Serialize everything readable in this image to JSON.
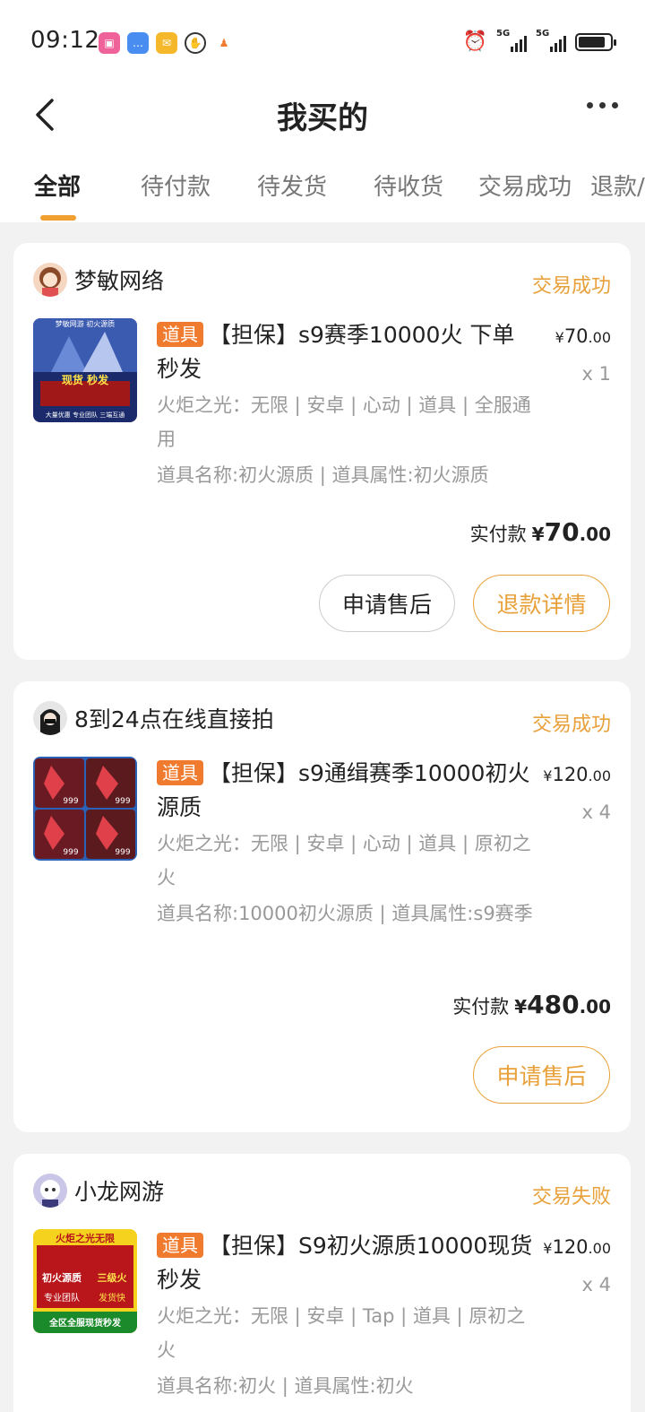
{
  "status_bar": {
    "time": "09:12",
    "network_1": "5G",
    "network_2": "5G",
    "battery_level": 0.85,
    "icons": [
      "bilibili-icon",
      "message-icon",
      "mail-icon",
      "hand-icon",
      "app-icon",
      "alarm-icon",
      "signal-icon",
      "battery-icon"
    ]
  },
  "nav": {
    "title": "我买的",
    "back_icon": "chevron-left-icon",
    "more_icon": "more-dots-icon"
  },
  "tabs": [
    {
      "label": "全部",
      "active": true
    },
    {
      "label": "待付款",
      "active": false
    },
    {
      "label": "待发货",
      "active": false
    },
    {
      "label": "待收货",
      "active": false
    },
    {
      "label": "交易成功",
      "active": false
    },
    {
      "label": "退款/",
      "active": false
    }
  ],
  "colors": {
    "accent": "#e8a13a",
    "tag": "#f07b2e",
    "indicator": "#f0a030",
    "muted": "#999999"
  },
  "orders": [
    {
      "seller": "梦敏网络",
      "status": "交易成功",
      "tag": "道具",
      "title": "【担保】s9赛季10000火 下单秒发",
      "attr_line_1": "火炬之光：无限 | 安卓 | 心动 | 道具 | 全服通用",
      "attr_line_2": "道具名称:初火源质 | 道具属性:初火源质",
      "price_currency": "¥",
      "price_int": "70",
      "price_dec": ".00",
      "qty": "x 1",
      "paid_label": "实付款",
      "paid_currency": "¥",
      "paid_int": "70",
      "paid_dec": ".00",
      "buttons": [
        "申请售后",
        "退款详情"
      ],
      "thumb_texts": [
        "梦敏网游 初火源质",
        "现货 秒发",
        "大量优惠 专业团队 三端互通"
      ]
    },
    {
      "seller": "8到24点在线直接拍",
      "status": "交易成功",
      "tag": "道具",
      "title": "【担保】s9通缉赛季10000初火源质",
      "attr_line_1": "火炬之光：无限 | 安卓 | 心动 | 道具 | 原初之火",
      "attr_line_2": "道具名称:10000初火源质 | 道具属性:s9赛季",
      "price_currency": "¥",
      "price_int": "120",
      "price_dec": ".00",
      "qty": "x 4",
      "paid_label": "实付款",
      "paid_currency": "¥",
      "paid_int": "480",
      "paid_dec": ".00",
      "buttons": [
        "申请售后"
      ],
      "thumb_texts": [
        "999",
        "999",
        "999",
        "999"
      ]
    },
    {
      "seller": "小龙网游",
      "status": "交易失败",
      "tag": "道具",
      "title": "【担保】S9初火源质10000现货秒发",
      "attr_line_1": "火炬之光：无限 | 安卓 | Tap | 道具 | 原初之火",
      "attr_line_2": "道具名称:初火 | 道具属性:初火",
      "price_currency": "¥",
      "price_int": "120",
      "price_dec": ".00",
      "qty": "x 4",
      "thumb_texts": [
        "火炬之光无限",
        "初火源质",
        "三级火",
        "专业团队",
        "发货快",
        "全区全服现货秒发"
      ]
    }
  ]
}
